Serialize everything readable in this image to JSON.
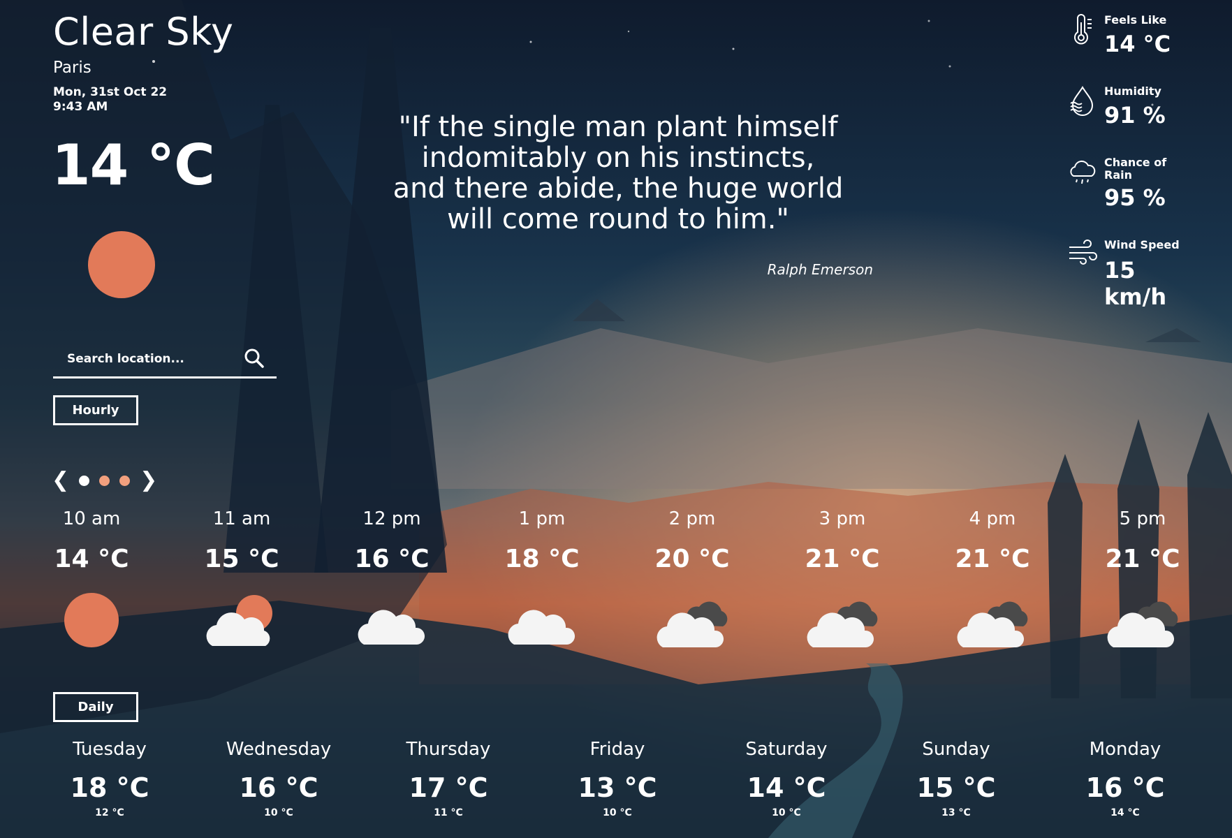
{
  "summary": {
    "condition": "Clear Sky",
    "city": "Paris",
    "date": "Mon, 31st Oct 22",
    "time": "9:43 AM",
    "temperature": "14 °C",
    "icon": "sun-icon"
  },
  "search": {
    "placeholder": "Search location..."
  },
  "buttons": {
    "hourly": "Hourly",
    "daily": "Daily"
  },
  "pager": {
    "prev": "❮",
    "next": "❯",
    "dots": 3,
    "active_dot": 1
  },
  "quote": {
    "text": "\"If the single man plant himself indomitably on his instincts, and there abide, the huge world will come round to him.\"",
    "author": "Ralph Emerson"
  },
  "metrics": [
    {
      "label": "Feels Like",
      "value": "14 °C",
      "icon": "thermometer-icon"
    },
    {
      "label": "Humidity",
      "value": "91 %",
      "icon": "humidity-icon"
    },
    {
      "label": "Chance of Rain",
      "value": "95 %",
      "icon": "rain-cloud-icon"
    },
    {
      "label": "Wind Speed",
      "value": "15 km/h",
      "icon": "wind-icon"
    }
  ],
  "hourly": [
    {
      "time": "10 am",
      "temp": "14 °C",
      "icon": "sun-icon"
    },
    {
      "time": "11 am",
      "temp": "15 °C",
      "icon": "cloud-sun-icon"
    },
    {
      "time": "12 pm",
      "temp": "16 °C",
      "icon": "cloud-icon"
    },
    {
      "time": "1 pm",
      "temp": "18 °C",
      "icon": "cloud-icon"
    },
    {
      "time": "2 pm",
      "temp": "20 °C",
      "icon": "cloudy-icon"
    },
    {
      "time": "3 pm",
      "temp": "21 °C",
      "icon": "cloudy-icon"
    },
    {
      "time": "4 pm",
      "temp": "21 °C",
      "icon": "cloudy-icon"
    },
    {
      "time": "5 pm",
      "temp": "21 °C",
      "icon": "cloudy-icon"
    }
  ],
  "daily": [
    {
      "day": "Tuesday",
      "high": "18 °C",
      "low": "12 °C"
    },
    {
      "day": "Wednesday",
      "high": "16 °C",
      "low": "10 °C"
    },
    {
      "day": "Thursday",
      "high": "17 °C",
      "low": "11 °C"
    },
    {
      "day": "Friday",
      "high": "13 °C",
      "low": "10 °C"
    },
    {
      "day": "Saturday",
      "high": "14 °C",
      "low": "10 °C"
    },
    {
      "day": "Sunday",
      "high": "15 °C",
      "low": "13 °C"
    },
    {
      "day": "Monday",
      "high": "16 °C",
      "low": "14 °C"
    }
  ],
  "colors": {
    "sun": "#e27a59",
    "cloud": "#f4f4f4",
    "dark_cloud": "#4a4a4a",
    "dot_active": "#ffffff",
    "dot_inactive": "#f2a07e"
  }
}
